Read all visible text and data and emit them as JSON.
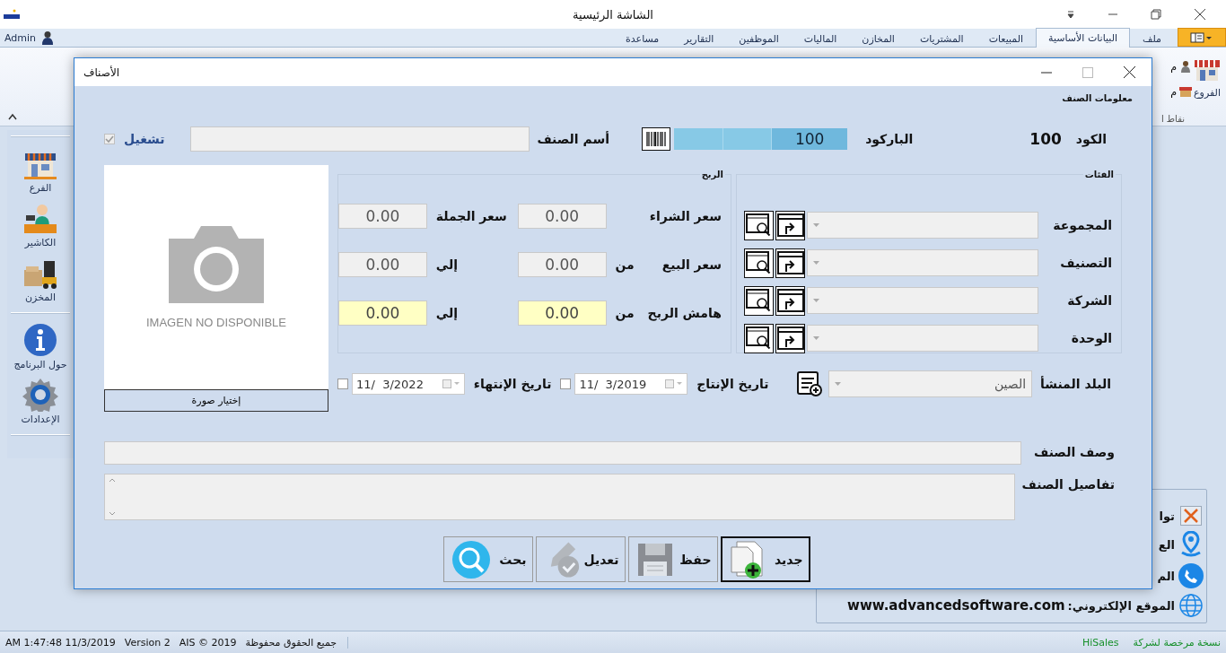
{
  "window": {
    "title": "الشاشة الرئيسية",
    "user": "Admin"
  },
  "ribbon": {
    "tabs": [
      {
        "label": "ملف",
        "selected": false
      },
      {
        "label": "البيانات الأساسية",
        "selected": true
      },
      {
        "label": "المبيعات",
        "selected": false
      },
      {
        "label": "المشتريات",
        "selected": false
      },
      {
        "label": "المخازن",
        "selected": false
      },
      {
        "label": "الماليات",
        "selected": false
      },
      {
        "label": "الموظفين",
        "selected": false
      },
      {
        "label": "التقارير",
        "selected": false
      },
      {
        "label": "مساعدة",
        "selected": false
      }
    ],
    "large_item": {
      "label": "الفروع"
    },
    "small_items": [
      {
        "label": "م"
      },
      {
        "label": "م"
      }
    ],
    "group_label": "نقاط ا"
  },
  "sidebar": {
    "groups": [
      {
        "items": [
          {
            "label": "الفرع"
          },
          {
            "label": "الكاشير"
          },
          {
            "label": "المخزن"
          }
        ]
      },
      {
        "items": [
          {
            "label": "حول البرنامج"
          },
          {
            "label": "الإعدادات"
          }
        ]
      }
    ]
  },
  "info_panel": {
    "rows": [
      {
        "label": "توا"
      },
      {
        "label": "الع"
      },
      {
        "label": "الم"
      },
      {
        "label": "الموقع الإلكتروني:",
        "value": "www.advancedsoftware.com"
      }
    ]
  },
  "dialog": {
    "title": "الأصناف",
    "section": "معلومات الصنف",
    "code": {
      "label": "الكود",
      "value": "100"
    },
    "barcode": {
      "label": "الباركود",
      "value": "100"
    },
    "name": {
      "label": "أسم الصنف"
    },
    "active": {
      "label": "تشغيل",
      "checked": true,
      "disabled": true
    },
    "image": {
      "placeholder": "IMAGEN NO DISPONIBLE",
      "button": "إختيار صورة"
    },
    "categories": {
      "title": "الفئات",
      "rows": [
        {
          "label": "المجموعة"
        },
        {
          "label": "التصنيف"
        },
        {
          "label": "الشركة"
        },
        {
          "label": "الوحدة"
        }
      ]
    },
    "profit": {
      "title": "الربح",
      "rows": [
        {
          "label": "سعر الشراء",
          "value": "0.00",
          "label_2": "سعر الجملة",
          "value_2": "0.00",
          "highlighted": false
        },
        {
          "label": "سعر البيع",
          "from": "من",
          "value": "0.00",
          "label_2": "إلي",
          "value_2": "0.00",
          "highlighted": false
        },
        {
          "label": "هامش الربح",
          "from": "من",
          "value": "0.00",
          "label_2": "إلي",
          "value_2": "0.00",
          "highlighted": true
        }
      ]
    },
    "origin": {
      "label": "البلد المنشأ",
      "value": "الصين"
    },
    "dates": [
      {
        "label": "تاريخ الإنتاج",
        "value": "11/  3/2019",
        "checked": false
      },
      {
        "label": "تاريخ الإنتهاء",
        "value": "11/  3/2022",
        "checked": false
      }
    ],
    "description": {
      "label": "وصف الصنف"
    },
    "details": {
      "label": "تفاصيل الصنف"
    },
    "buttons": [
      {
        "label": "جديد",
        "selected": true,
        "disabled": false
      },
      {
        "label": "حفظ",
        "selected": false,
        "disabled": true
      },
      {
        "label": "تعديل",
        "selected": false,
        "disabled": true
      },
      {
        "label": "بحث",
        "selected": false,
        "disabled": false
      }
    ]
  },
  "status_bar": {
    "left": [
      "جميع الحقوق محفوظة",
      "AIS © 2019",
      "Version 2",
      "AM 1:47:48 11/3/2019"
    ],
    "license": "نسخة مرخصة لشركة",
    "company": "HiSales"
  }
}
